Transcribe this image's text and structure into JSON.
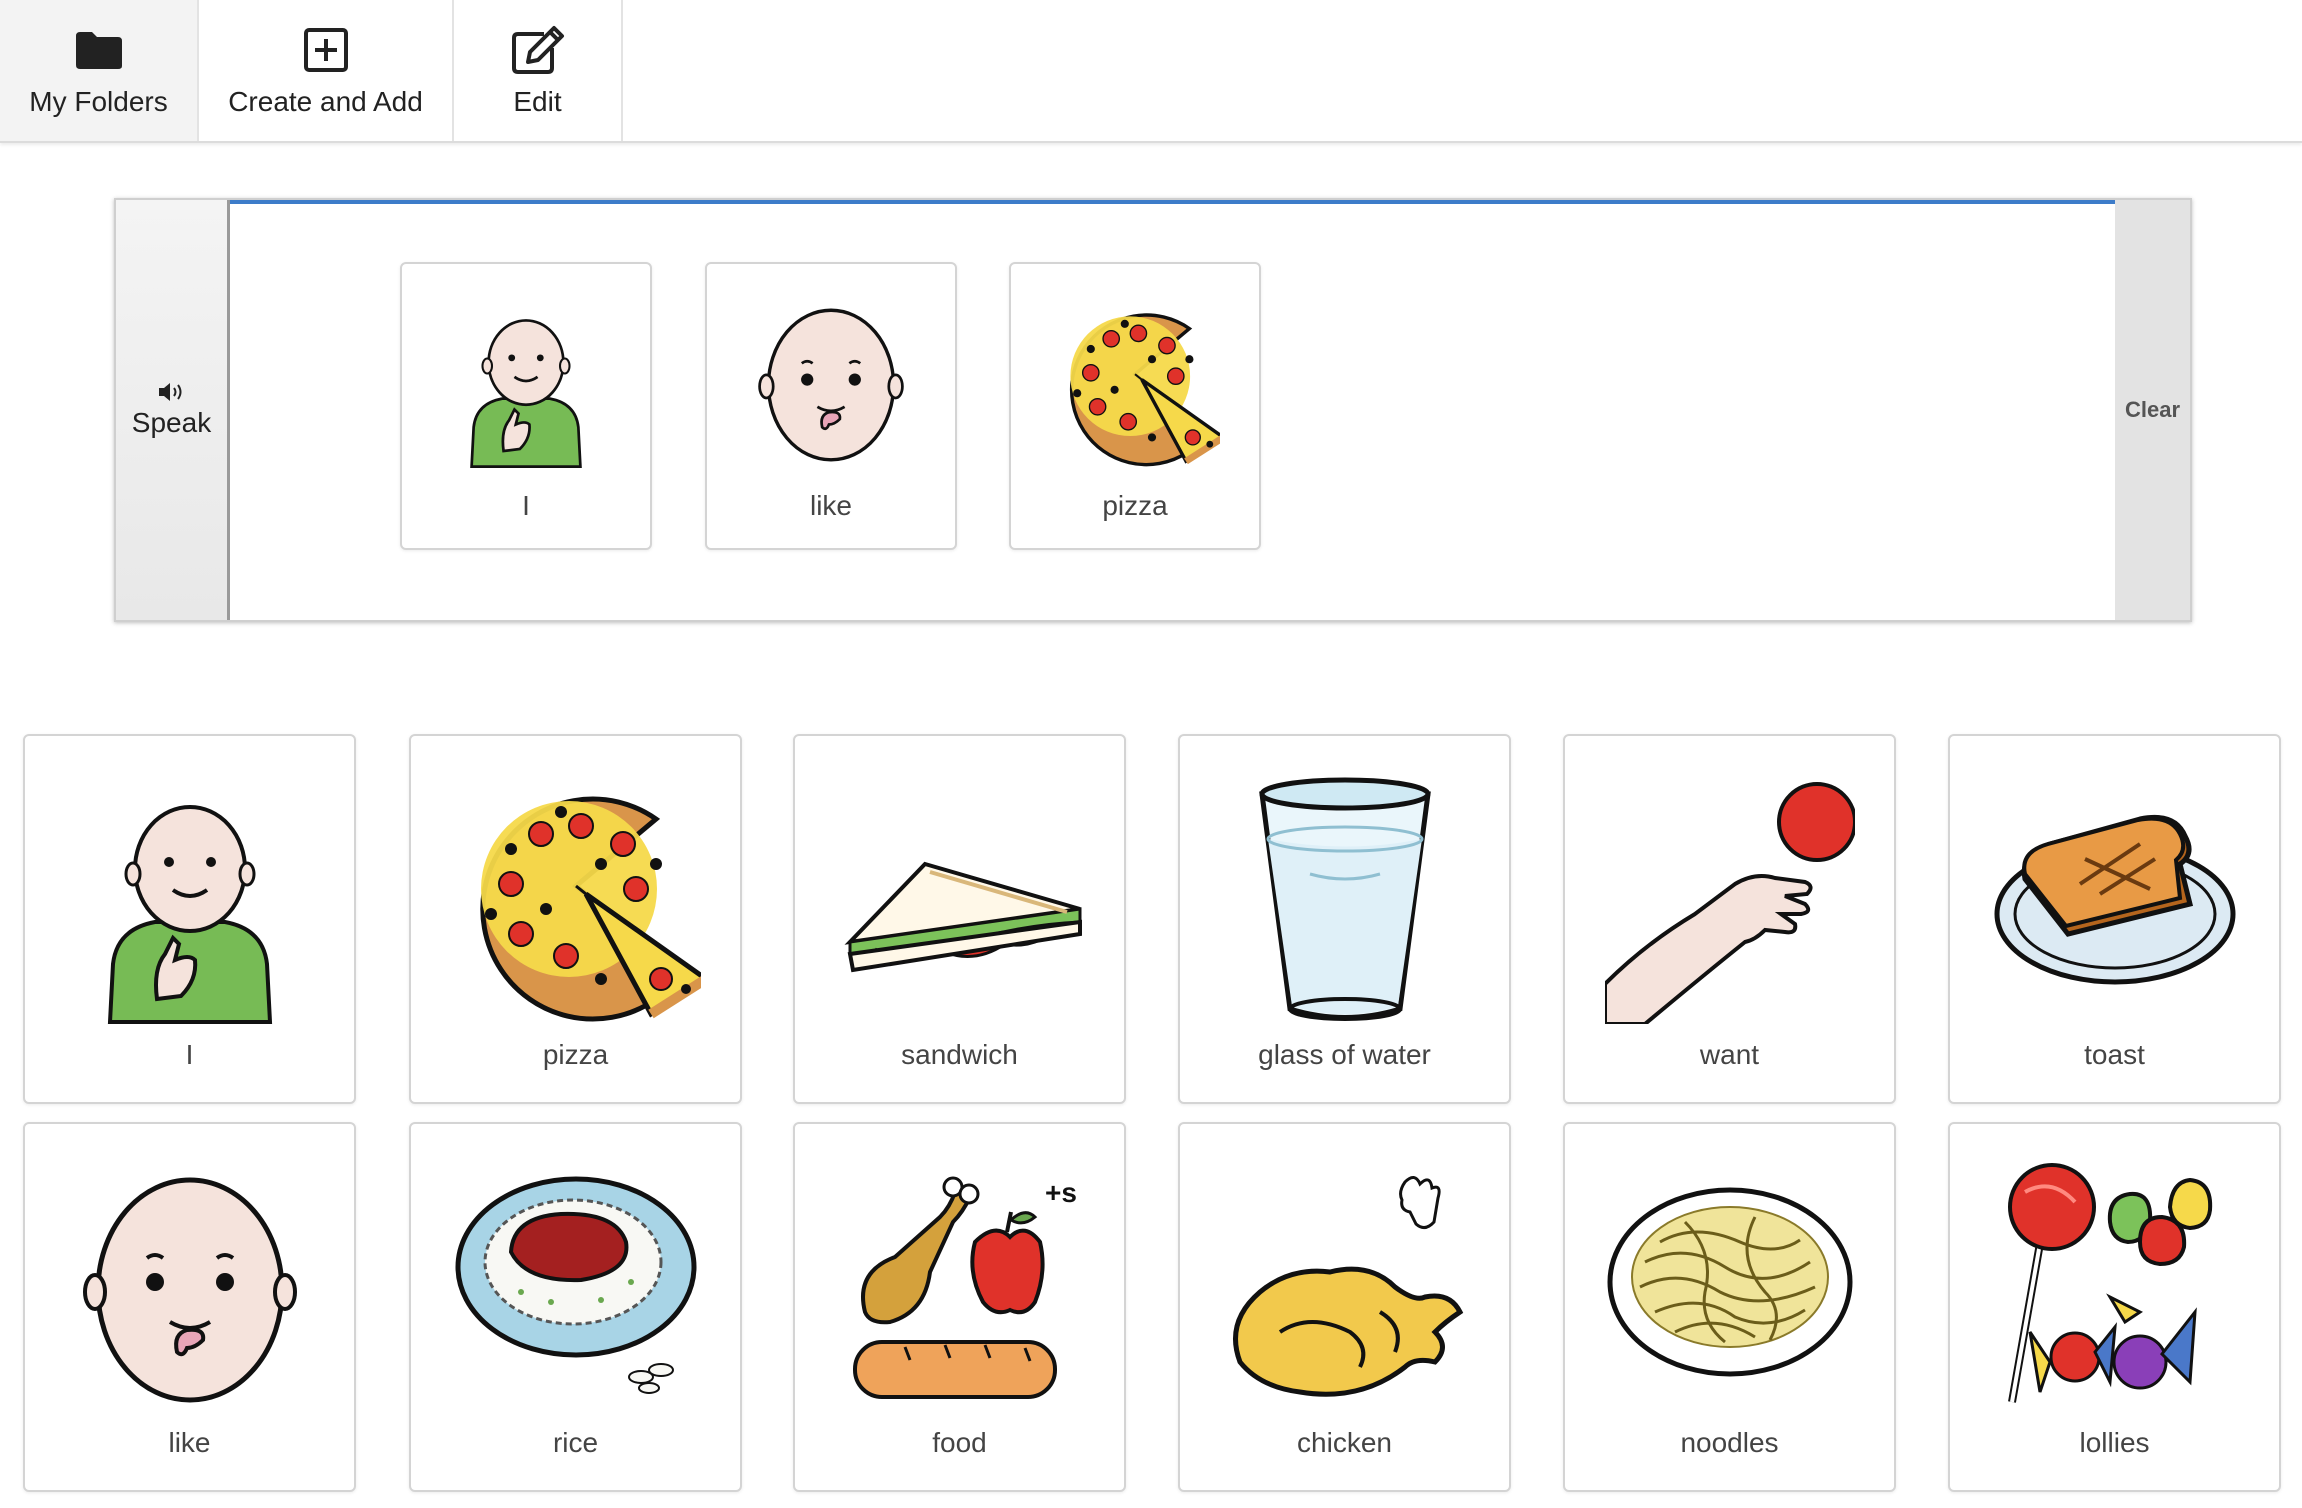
{
  "toolbar": {
    "folders_label": "My Folders",
    "create_label": "Create and Add",
    "edit_label": "Edit"
  },
  "sentence_bar": {
    "speak_label": "Speak",
    "clear_label": "Clear",
    "words": [
      "I",
      "like",
      "pizza"
    ]
  },
  "tiles": {
    "row1": [
      "I",
      "pizza",
      "sandwich",
      "glass of water",
      "want",
      "toast"
    ],
    "row2": [
      "like",
      "rice",
      "food",
      "chicken",
      "noodles",
      "lollies"
    ]
  },
  "food_plural_marker": "+s",
  "colors": {
    "accent": "#3d7cc9",
    "green_shirt": "#77bb55",
    "pizza_crust": "#d9954a",
    "pizza_cheese": "#f6d94a",
    "tomato_red": "#e0322a"
  }
}
